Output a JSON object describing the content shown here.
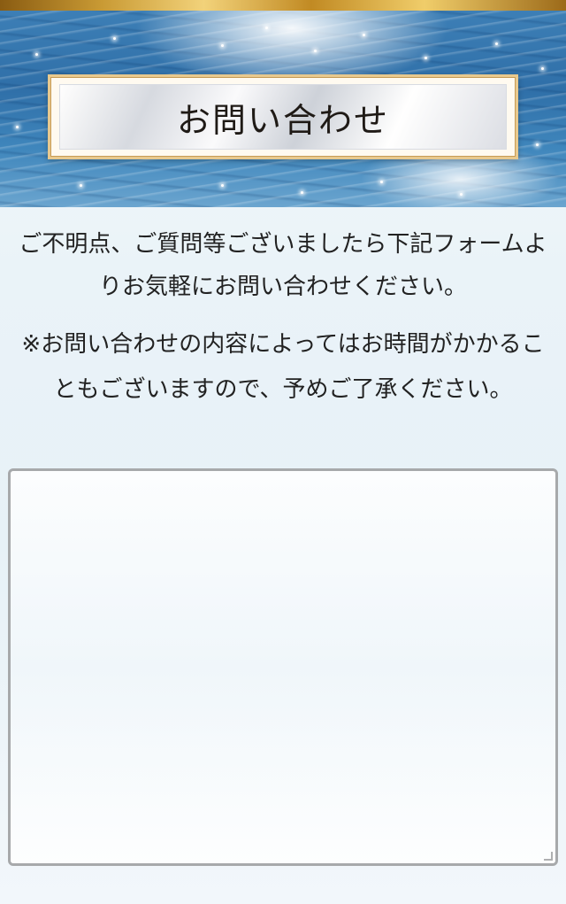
{
  "header": {
    "title": "お問い合わせ"
  },
  "content": {
    "intro": "ご不明点、ご質問等ございましたら下記フォームよりお気軽にお問い合わせください。",
    "note": "※お問い合わせの内容によってはお時間がかかることもございますので、予めご了承ください。"
  },
  "colors": {
    "gold_bar": "#c99a34",
    "sea_blue": "#2f6fa8",
    "frame_gold": "#e8c98e",
    "text": "#222222",
    "form_border": "#a7a9ab"
  }
}
